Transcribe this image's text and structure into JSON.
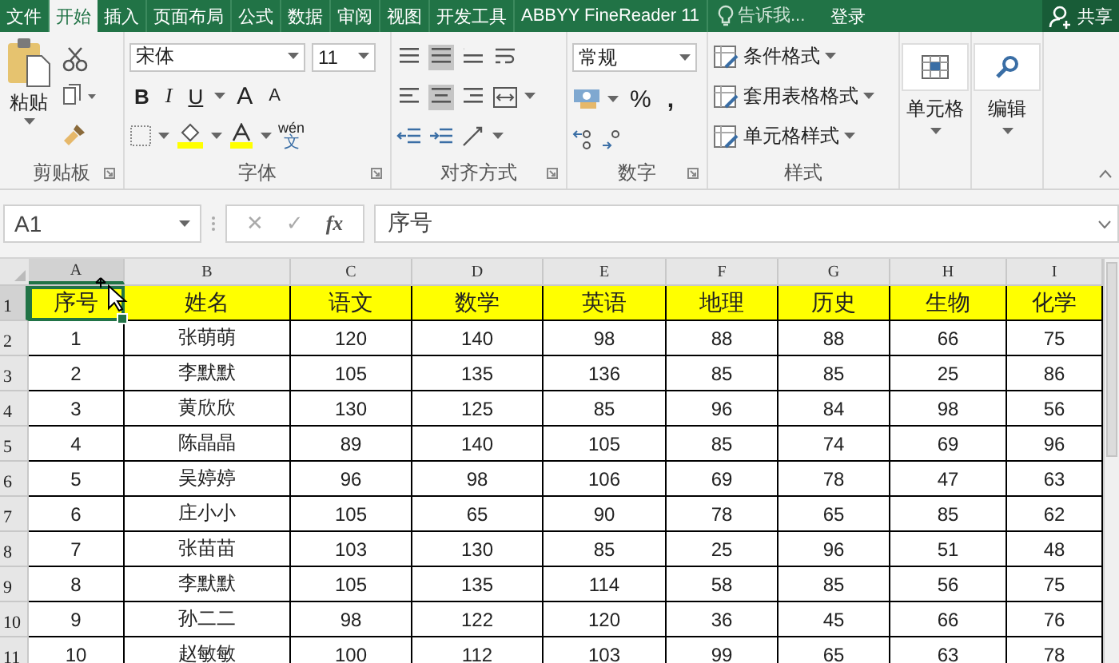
{
  "menu_tabs": [
    {
      "label": "文件",
      "selected": false
    },
    {
      "label": "开始",
      "selected": true
    },
    {
      "label": "插入",
      "selected": false
    },
    {
      "label": "页面布局",
      "selected": false
    },
    {
      "label": "公式",
      "selected": false
    },
    {
      "label": "数据",
      "selected": false
    },
    {
      "label": "审阅",
      "selected": false
    },
    {
      "label": "视图",
      "selected": false
    },
    {
      "label": "开发工具",
      "selected": false
    },
    {
      "label": "ABBYY FineReader 11",
      "selected": false
    }
  ],
  "tell_me": {
    "placeholder": "告诉我..."
  },
  "sign_in": "登录",
  "share": "共享",
  "ribbon": {
    "clipboard": {
      "paste": "粘贴",
      "label": "剪贴板"
    },
    "font": {
      "name": "宋体",
      "size": "11",
      "bold": "B",
      "italic": "I",
      "underline": "U",
      "grow": "A",
      "shrink": "A",
      "phonetic_top": "wén",
      "phonetic_bottom": "文",
      "label": "字体"
    },
    "alignment": {
      "label": "对齐方式"
    },
    "number": {
      "format": "常规",
      "percent": "%",
      "comma": ",",
      "label": "数字"
    },
    "styles": {
      "items": [
        "条件格式",
        "套用表格格式",
        "单元格样式"
      ],
      "label": "样式"
    },
    "cells": "单元格",
    "editing": "编辑"
  },
  "formula_bar": {
    "name_box": "A1",
    "cancel": "✕",
    "enter": "✓",
    "function": "fx",
    "value": "序号"
  },
  "sheet": {
    "columns": [
      {
        "label": "A",
        "selected": true
      },
      {
        "label": "B",
        "selected": false
      },
      {
        "label": "C",
        "selected": false
      },
      {
        "label": "D",
        "selected": false
      },
      {
        "label": "E",
        "selected": false
      },
      {
        "label": "F",
        "selected": false
      },
      {
        "label": "G",
        "selected": false
      },
      {
        "label": "H",
        "selected": false
      },
      {
        "label": "I",
        "selected": false
      }
    ],
    "rows": [
      {
        "number": "1",
        "selected": true,
        "kind": "header",
        "cells": [
          "序号",
          "姓名",
          "语文",
          "数学",
          "英语",
          "地理",
          "历史",
          "生物",
          "化学"
        ]
      },
      {
        "number": "2",
        "selected": false,
        "kind": "data",
        "cells": [
          "1",
          "张萌萌",
          "120",
          "140",
          "98",
          "88",
          "88",
          "66",
          "75"
        ]
      },
      {
        "number": "3",
        "selected": false,
        "kind": "data",
        "cells": [
          "2",
          "李默默",
          "105",
          "135",
          "136",
          "85",
          "85",
          "25",
          "86"
        ]
      },
      {
        "number": "4",
        "selected": false,
        "kind": "data",
        "cells": [
          "3",
          "黄欣欣",
          "130",
          "125",
          "85",
          "96",
          "84",
          "98",
          "56"
        ]
      },
      {
        "number": "5",
        "selected": false,
        "kind": "data",
        "cells": [
          "4",
          "陈晶晶",
          "89",
          "140",
          "105",
          "85",
          "74",
          "69",
          "96"
        ]
      },
      {
        "number": "6",
        "selected": false,
        "kind": "data",
        "cells": [
          "5",
          "吴婷婷",
          "96",
          "98",
          "106",
          "69",
          "78",
          "47",
          "63"
        ]
      },
      {
        "number": "7",
        "selected": false,
        "kind": "data",
        "cells": [
          "6",
          "庄小小",
          "105",
          "65",
          "90",
          "78",
          "65",
          "85",
          "62"
        ]
      },
      {
        "number": "8",
        "selected": false,
        "kind": "data",
        "cells": [
          "7",
          "张苗苗",
          "103",
          "130",
          "85",
          "25",
          "96",
          "51",
          "48"
        ]
      },
      {
        "number": "9",
        "selected": false,
        "kind": "data",
        "cells": [
          "8",
          "李默默",
          "105",
          "135",
          "114",
          "58",
          "85",
          "56",
          "75"
        ]
      },
      {
        "number": "10",
        "selected": false,
        "kind": "data",
        "cells": [
          "9",
          "孙二二",
          "98",
          "122",
          "120",
          "36",
          "45",
          "66",
          "76"
        ]
      },
      {
        "number": "11",
        "selected": false,
        "kind": "data",
        "cells": [
          "10",
          "赵敏敏",
          "100",
          "112",
          "103",
          "99",
          "65",
          "63",
          "78"
        ]
      }
    ]
  }
}
